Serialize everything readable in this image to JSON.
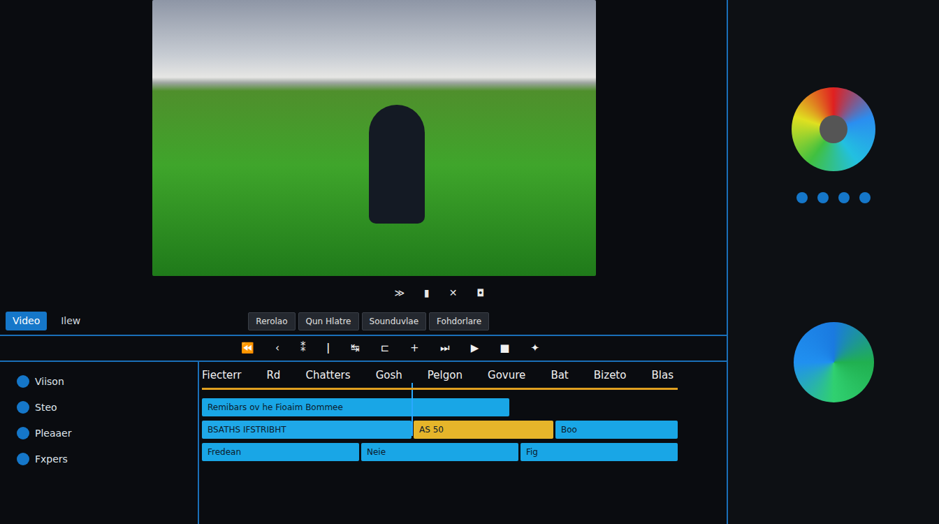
{
  "left_tabs": [
    {
      "label": "Video",
      "selected": true
    },
    {
      "label": "Ilew",
      "selected": false
    }
  ],
  "transport": [
    "≫",
    "▮",
    "✕",
    "◘"
  ],
  "panel_tabs": [
    "Rerolao",
    "Qun Hlatre",
    "Sounduvlae",
    "Fohdorlare"
  ],
  "controls": [
    "⏪",
    "‹",
    "⁑",
    "ǀ",
    "↹",
    "⊏",
    "+",
    "⏭",
    "▶",
    "■",
    "✦"
  ],
  "ruler": {
    "labels": [
      "Fiecterr",
      "Rd",
      "Chatters",
      "Gosh",
      "Pelgon",
      "Govure",
      "Bat",
      "Bizeto",
      "Blas"
    ],
    "playhead": {
      "level": 0.44
    }
  },
  "sidebar": {
    "items": [
      "Viison",
      "Steo",
      "Pleaaer",
      "Fxpers"
    ]
  },
  "tracks": [
    {
      "clips": [
        "Remibars ov he Fioaim Bommee"
      ]
    },
    {
      "clips": [
        "BSATHS IFSTRIBHT",
        "AS 50",
        "Boo"
      ]
    },
    {
      "clips": [
        "Fredean",
        "Neie",
        "Fig"
      ]
    }
  ]
}
